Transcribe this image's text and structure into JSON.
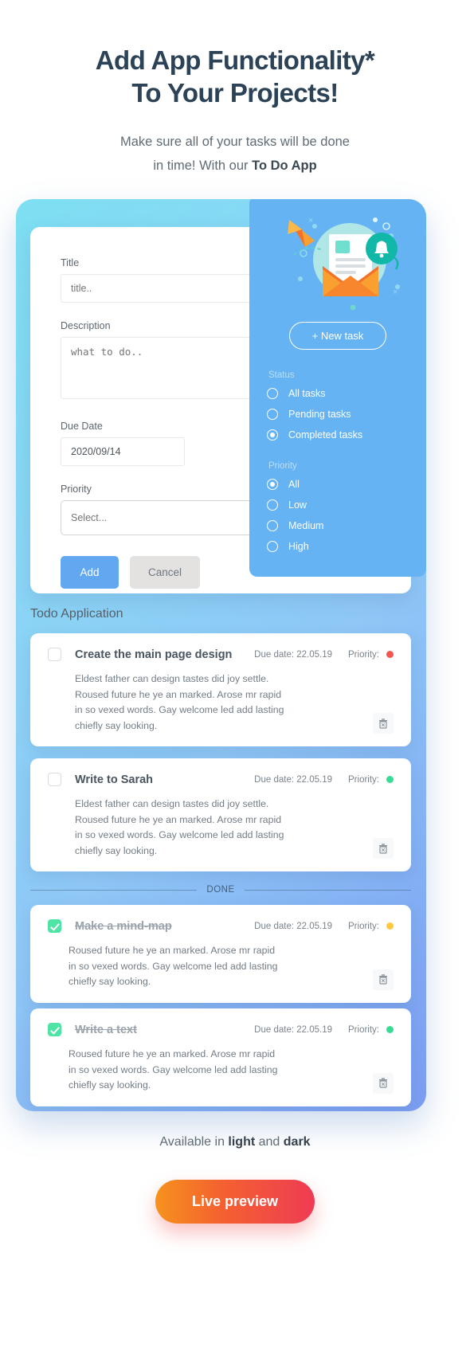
{
  "header": {
    "headline_line1": "Add App Functionality*",
    "headline_line2": "To Your Projects!",
    "subhead_line1": "Make sure all of your tasks will be done",
    "subhead_line2_prefix": "in time! With our ",
    "subhead_line2_bold": "To Do App"
  },
  "form": {
    "title_label": "Title",
    "title_placeholder": "title..",
    "description_label": "Description",
    "description_placeholder": "what to do..",
    "due_date_label": "Due Date",
    "due_date_value": "2020/09/14",
    "priority_label": "Priority",
    "priority_value": "Select...",
    "add_label": "Add",
    "cancel_label": "Cancel"
  },
  "panel": {
    "new_task_label": "+  New task",
    "status_label": "Status",
    "status_options": [
      {
        "label": "All tasks",
        "selected": false
      },
      {
        "label": "Pending tasks",
        "selected": false
      },
      {
        "label": "Completed tasks",
        "selected": true
      }
    ],
    "priority_label": "Priority",
    "priority_options": [
      {
        "label": "All",
        "selected": true
      },
      {
        "label": "Low",
        "selected": false
      },
      {
        "label": "Medium",
        "selected": false
      },
      {
        "label": "High",
        "selected": false
      }
    ]
  },
  "list": {
    "title": "Todo Application",
    "due_prefix": "Due date: ",
    "priority_prefix": "Priority:",
    "done_divider": "DONE",
    "tasks": [
      {
        "name": "Create the main page design",
        "due": "Due date: 22.05.19",
        "priority_label": "Priority:",
        "priority_color": "#f6554f",
        "completed": false,
        "description": "Eldest father can design tastes did joy settle.\nRoused future he ye an marked. Arose mr rapid\nin so vexed words. Gay welcome led add lasting\nchiefly say looking."
      },
      {
        "name": "Write to Sarah",
        "due": "Due date: 22.05.19",
        "priority_label": "Priority:",
        "priority_color": "#37dc95",
        "completed": false,
        "description": "Eldest father can design tastes did joy settle.\nRoused future he ye an marked. Arose mr rapid\nin so vexed words. Gay welcome led add lasting\nchiefly say looking."
      },
      {
        "name": "Make a mind-map",
        "due": "Due date: 22.05.19",
        "priority_label": "Priority:",
        "priority_color": "#fcc93f",
        "completed": true,
        "description": "Roused future he ye an marked. Arose mr rapid\nin so vexed words. Gay welcome led add lasting\nchiefly say looking."
      },
      {
        "name": "Write a text",
        "due": "Due date: 22.05.19",
        "priority_label": "Priority:",
        "priority_color": "#37dc95",
        "completed": true,
        "description": "Roused future he ye an marked. Arose mr rapid\nin so vexed words. Gay welcome led add lasting\nchiefly say looking."
      }
    ]
  },
  "footer": {
    "avail_prefix": "Available in ",
    "avail_bold1": "light",
    "avail_middle": " and ",
    "avail_bold2": "dark",
    "live_preview_label": "Live preview"
  },
  "colors": {
    "accent_blue": "#66b3f4",
    "headline": "#2b4257",
    "cta_gradient_start": "#f7921e",
    "cta_gradient_end": "#ef3b54"
  }
}
